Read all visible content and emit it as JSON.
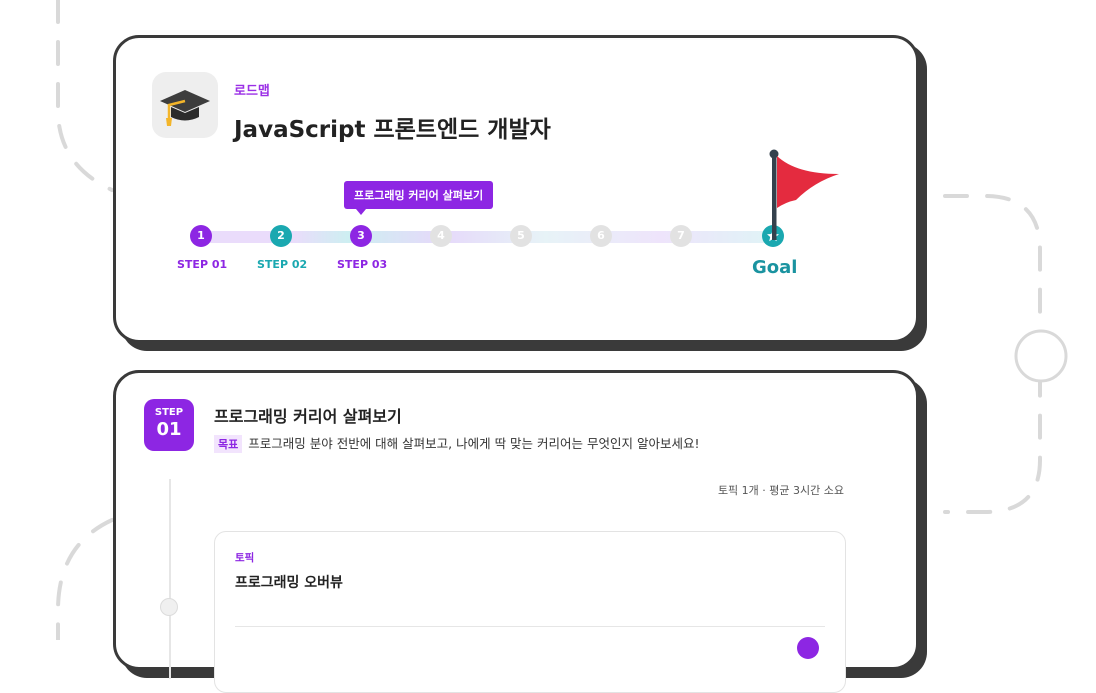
{
  "roadmap": {
    "label": "로드맵",
    "title": "JavaScript 프론트엔드 개발자",
    "tooltip": "프로그래밍 커리어 살펴보기",
    "nodes": [
      "1",
      "2",
      "3",
      "4",
      "5",
      "6",
      "7"
    ],
    "step_labels": [
      "STEP 01",
      "STEP 02",
      "STEP 03"
    ],
    "goal_label": "Goal",
    "icon": "graduation-cap-icon",
    "flag_icon": "flag-icon",
    "goal_icon": "star-icon"
  },
  "step": {
    "badge_top": "STEP",
    "badge_num": "01",
    "title": "프로그래밍 커리어 살펴보기",
    "goal_tag": "목표",
    "goal_text": "프로그래밍 분야 전반에 대해 살펴보고, 나에게 딱 맞는 커리어는 무엇인지 알아보세요!",
    "meta": "토픽 1개 · 평균 3시간 소요"
  },
  "topic": {
    "label": "토픽",
    "title": "프로그래밍 오버뷰"
  },
  "colors": {
    "purple": "#8d26e3",
    "teal": "#1aa8b0",
    "flag_red": "#e42b3f",
    "border": "#3a3a3a"
  }
}
